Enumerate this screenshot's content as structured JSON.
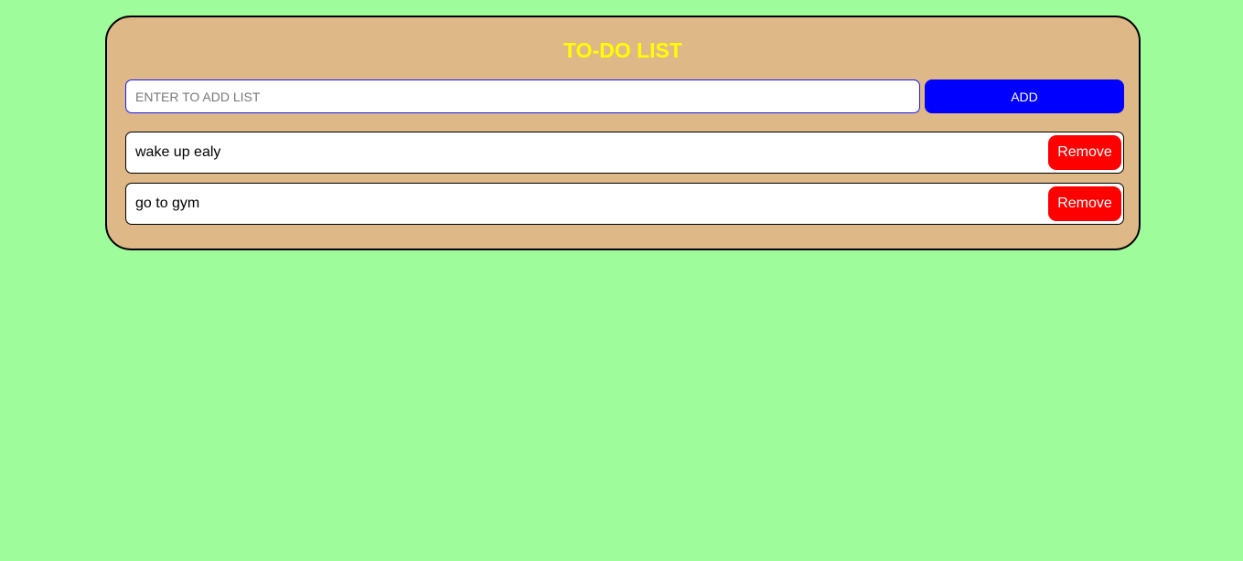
{
  "app": {
    "title": "TO-DO LIST"
  },
  "add_form": {
    "input_value": "",
    "input_placeholder": "ENTER TO ADD LIST",
    "add_label": "ADD"
  },
  "tasks": [
    {
      "text": "wake up ealy",
      "remove_label": "Remove"
    },
    {
      "text": "go to gym",
      "remove_label": "Remove"
    }
  ],
  "colors": {
    "page_background": "#9ffc9b",
    "card_background": "#deb887",
    "title": "#ffff00",
    "add_button": "#0000ff",
    "remove_button": "#ff0000"
  }
}
